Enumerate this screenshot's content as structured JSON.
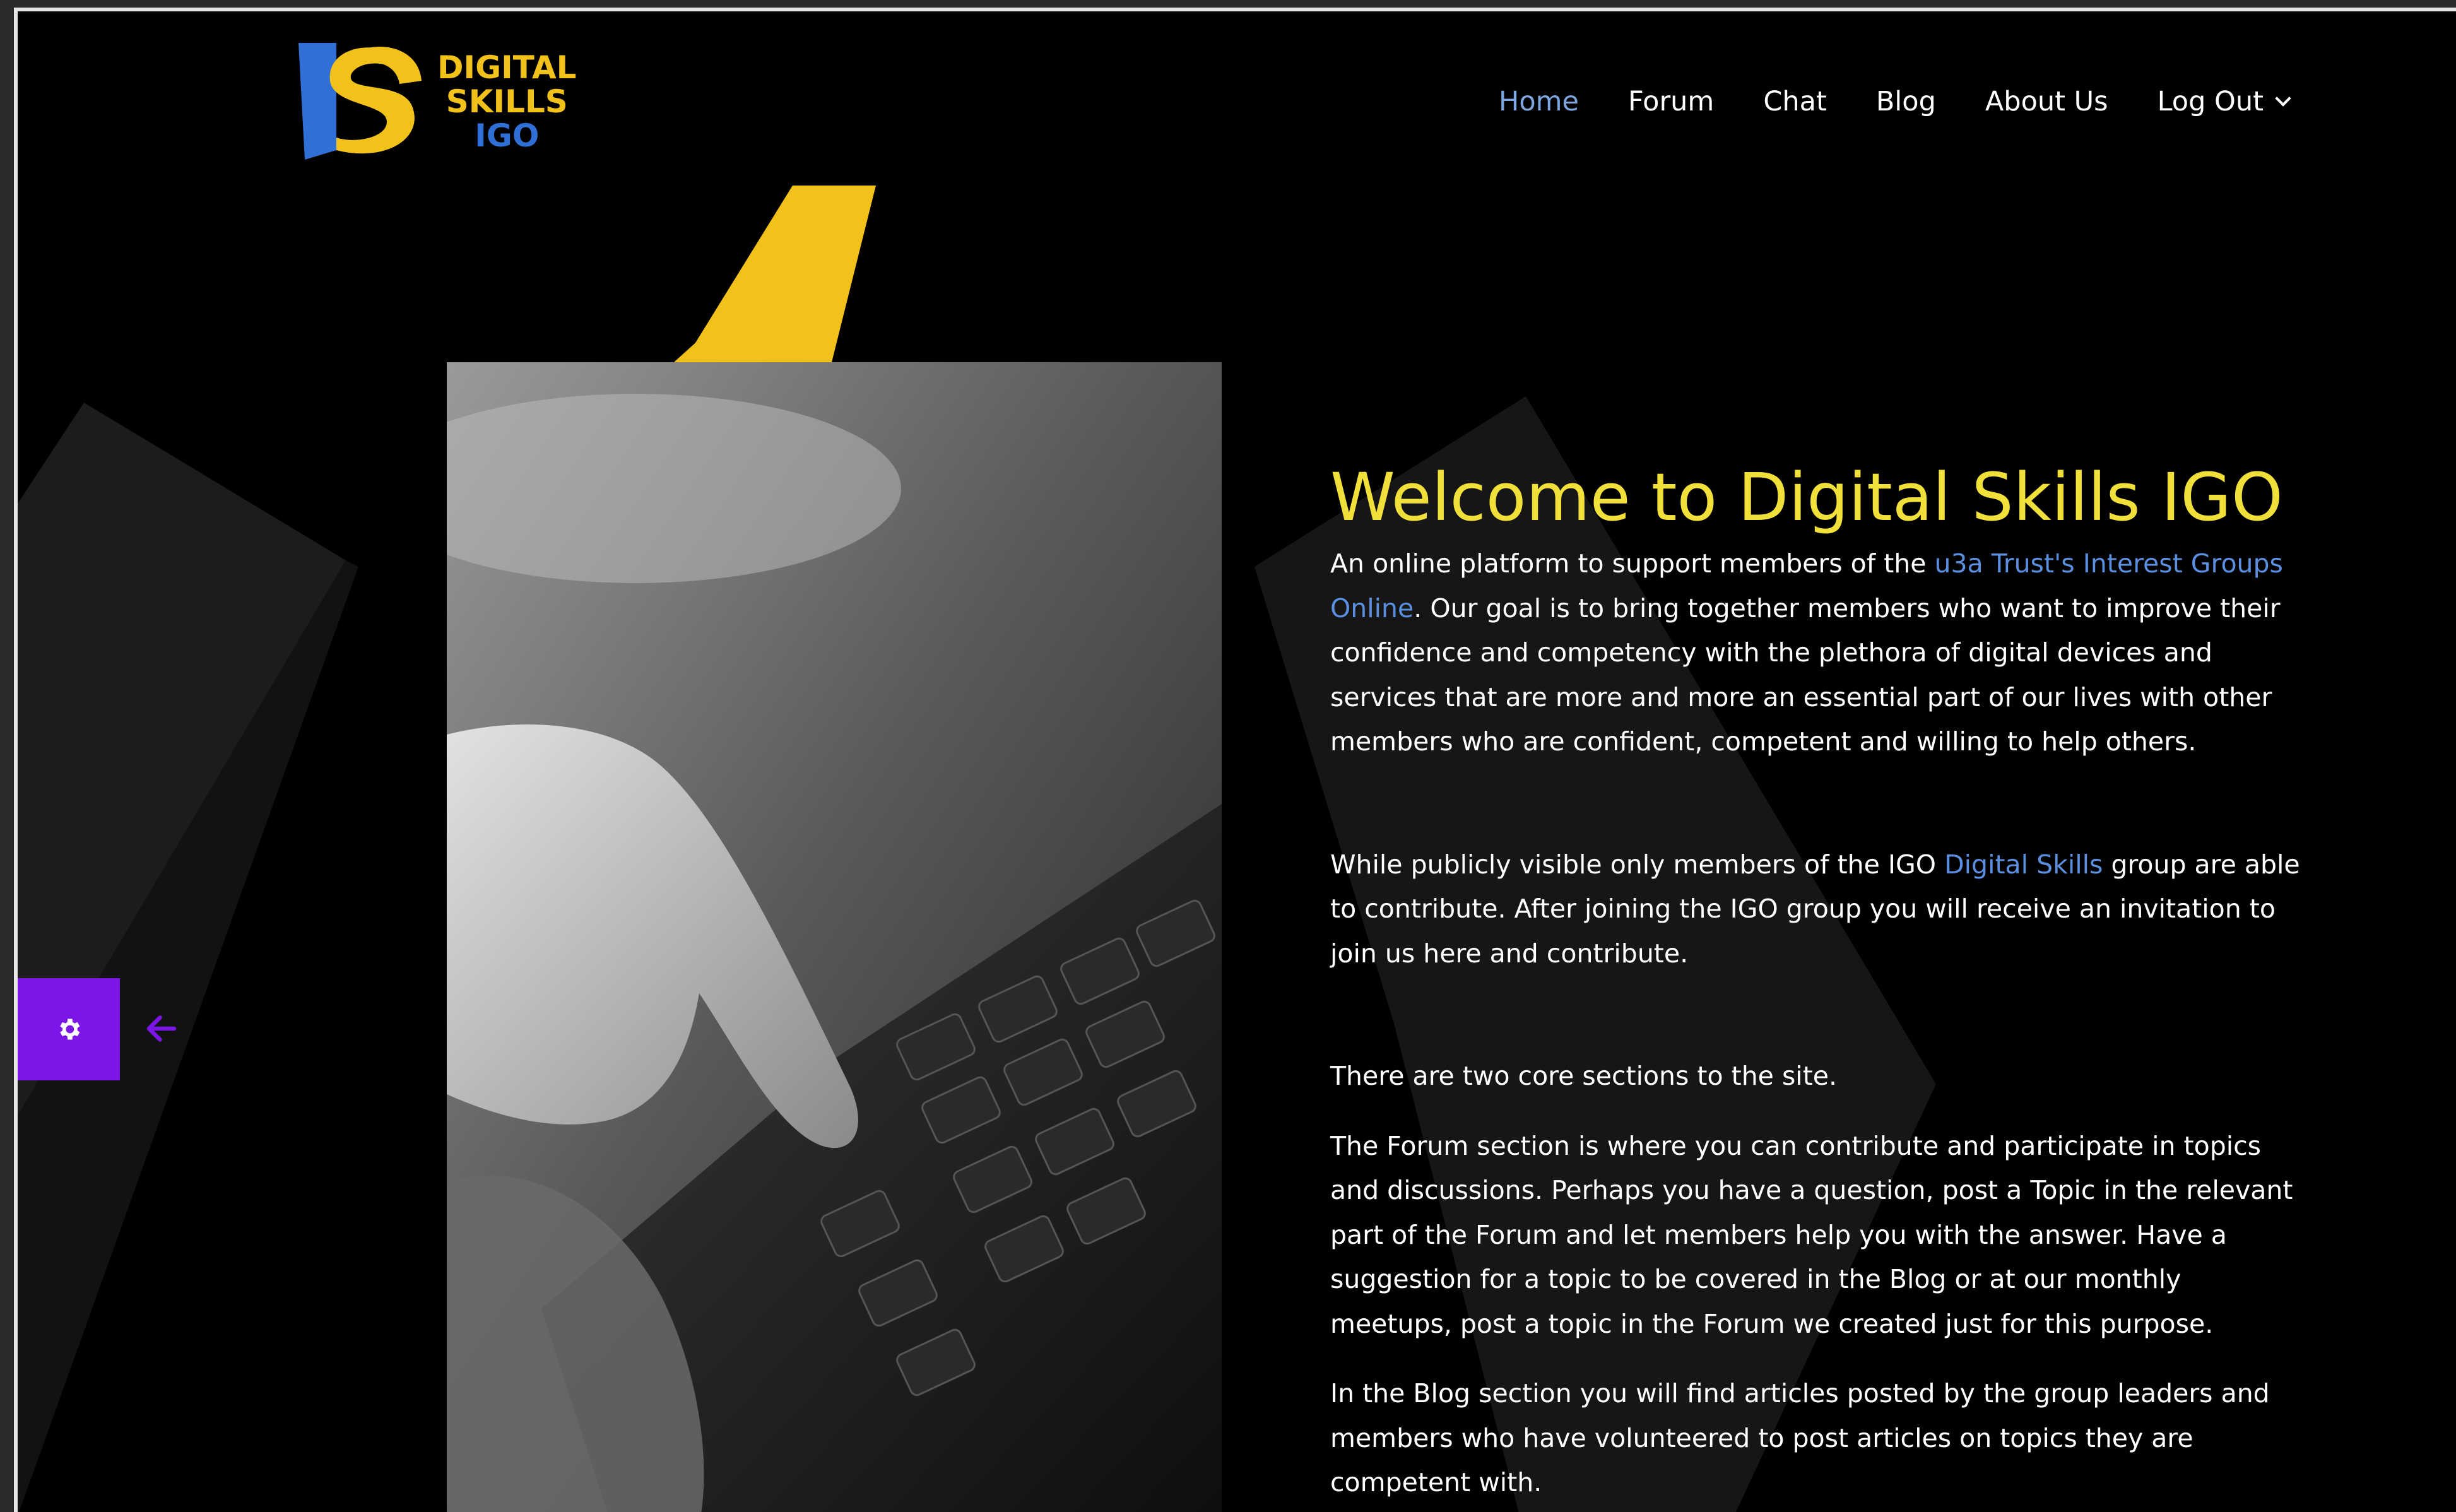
{
  "logo": {
    "line1": "DIGITAL",
    "line2": "SKILLS",
    "line3": "IGO"
  },
  "nav": {
    "items": [
      {
        "label": "Home"
      },
      {
        "label": "Forum"
      },
      {
        "label": "Chat"
      },
      {
        "label": "Blog"
      },
      {
        "label": "About Us"
      },
      {
        "label": "Log Out"
      }
    ]
  },
  "colors": {
    "accent_yellow": "#f2e03a",
    "logo_blue": "#2f6fd6",
    "link_blue": "#5b8fe0",
    "settings_purple": "#7b16e6",
    "background": "#000000"
  },
  "main": {
    "title": "Welcome to Digital Skills IGO",
    "intro_pre": "An online platform to support members of the ",
    "intro_link": "u3a Trust's Interest Groups Online",
    "intro_post": ". Our goal is to bring together members who want to improve their confidence and competency with the plethora of digital devices and services that are more and more an essential part of our lives with other members who are confident, competent and willing to help others.",
    "para2_pre": "While publicly visible only members of the IGO ",
    "para2_link": "Digital Skills",
    "para2_post": " group are able to contribute. After joining the IGO group you will receive an invitation to join us here and contribute.",
    "para3": "There are two core sections to the site.",
    "para4": "The Forum section is where you can contribute and participate in topics and discussions.  Perhaps you have a question, post a Topic in the relevant part of the Forum and let members help you with the answer.  Have a suggestion for a topic to be covered in the Blog or at our monthly meetups, post a topic in the Forum we created just for this purpose.",
    "para5": "In the Blog section you will find articles posted by the group leaders and members who have volunteered to post articles on topics they are competent with."
  },
  "icons": {
    "settings": "gear-icon",
    "arrow": "arrow-left-icon",
    "dropdown": "chevron-down-icon"
  }
}
